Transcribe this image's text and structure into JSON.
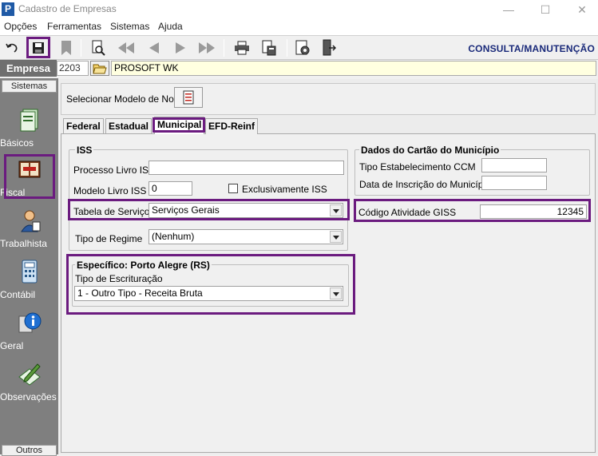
{
  "window": {
    "icon_letter": "P",
    "title": "Cadastro de Empresas",
    "minimize": "—",
    "maximize": "☐",
    "close": "✕"
  },
  "menu": [
    "Opções",
    "Ferramentas",
    "Sistemas",
    "Ajuda"
  ],
  "toolbar": {
    "mode_label": "CONSULTA/MANUTENÇÃO"
  },
  "empresa": {
    "label": "Empresa",
    "code": "2203",
    "name": "PROSOFT WK"
  },
  "sidebar": {
    "header": "Sistemas",
    "items": [
      "Básicos",
      "Fiscal",
      "Trabalhista",
      "Contábil",
      "Geral",
      "Observações"
    ],
    "footer": "Outros"
  },
  "model": {
    "label": "Selecionar Modelo de Nota"
  },
  "tabs": [
    "Federal",
    "Estadual",
    "Municipal",
    "EFD-Reinf"
  ],
  "iss": {
    "title": "ISS",
    "processo_label": "Processo Livro ISS",
    "processo_value": "",
    "modelo_label": "Modelo Livro ISS",
    "modelo_value": "0",
    "exclusivamente_label": "Exclusivamente ISS",
    "tabela_label": "Tabela de Serviços",
    "tabela_value": "Serviços Gerais",
    "regime_label": "Tipo de Regime",
    "regime_value": "(Nenhum)"
  },
  "especifico": {
    "title": "Específico: Porto Alegre (RS)",
    "escrituracao_label": "Tipo de Escrituração",
    "escrituracao_value": "1 - Outro Tipo - Receita Bruta"
  },
  "cartao": {
    "title": "Dados do Cartão do Município",
    "ccm_label": "Tipo Estabelecimento CCM",
    "ccm_value": "",
    "inscricao_label": "Data de Inscrição do Município",
    "inscricao_value": "",
    "giss_label": "Código Atividade GISS",
    "giss_value": "12345"
  }
}
